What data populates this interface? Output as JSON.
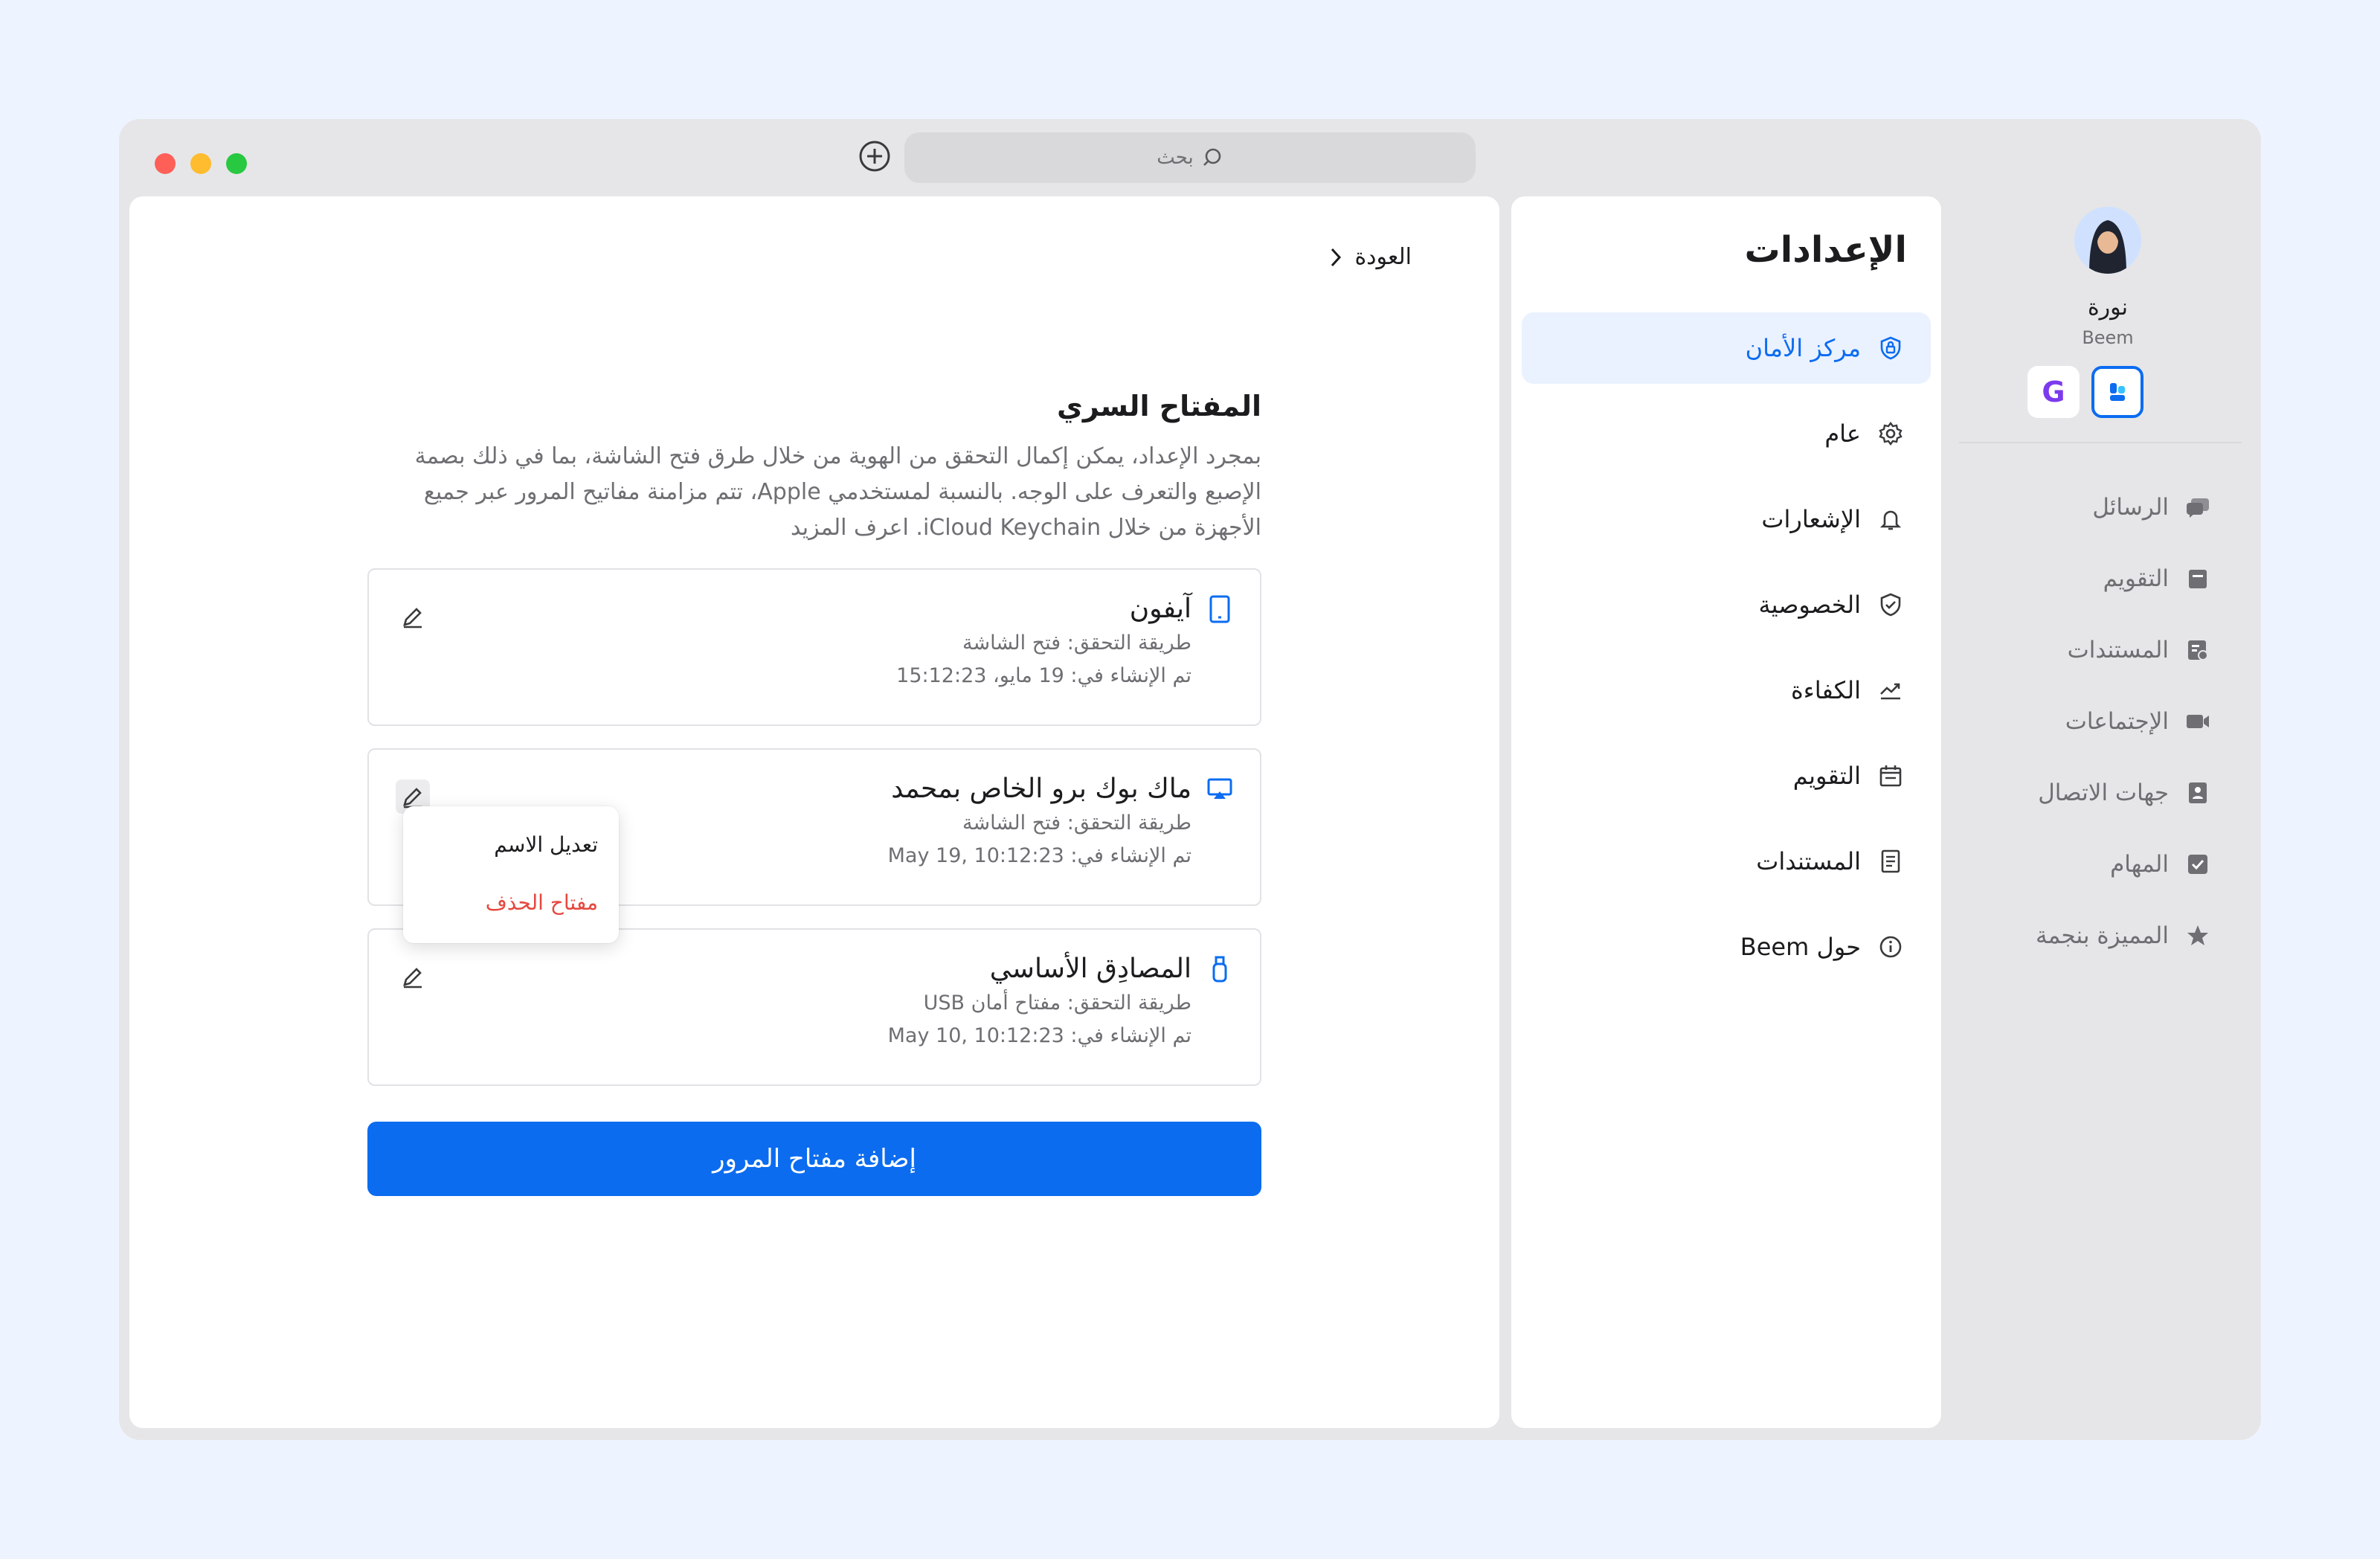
{
  "window": {
    "search_placeholder": "بحث"
  },
  "main": {
    "back_label": "العودة",
    "title": "المفتاح السري",
    "description": "بمجرد الإعداد، يمكن إكمال التحقق من الهوية من خلال طرق فتح الشاشة، بما في ذلك بصمة الإصبع والتعرف على الوجه. بالنسبة لمستخدمي Apple، تتم مزامنة مفاتيح المرور عبر جميع الأجهزة من خلال iCloud Keychain. اعرف المزيد",
    "method_label": "طريقة التحقق:",
    "created_label": "تم الإنشاء في:",
    "keys": [
      {
        "name": "آيفون",
        "icon": "phone-icon",
        "method": "فتح الشاشة",
        "created": "19 مايو، 15:12:23"
      },
      {
        "name": "ماك بوك برو الخاص بمحمد",
        "icon": "laptop-icon",
        "method": "فتح الشاشة",
        "created": "May 19, 10:12:23"
      },
      {
        "name": "المصادِق الأساسي",
        "icon": "usb-key-icon",
        "method": "مفتاح أمان USB",
        "created": "May 10, 10:12:23"
      }
    ],
    "menu": {
      "rename": "تعديل الاسم",
      "delete": "مفتاح الحذف"
    },
    "add_button": "إضافة مفتاح المرور"
  },
  "settings": {
    "title": "الإعدادات",
    "items": [
      {
        "label": "مركز الأمان",
        "icon": "shield-lock-icon",
        "active": true
      },
      {
        "label": "عام",
        "icon": "gear-icon"
      },
      {
        "label": "الإشعارات",
        "icon": "bell-icon"
      },
      {
        "label": "الخصوصية",
        "icon": "shield-check-icon"
      },
      {
        "label": "الكفاءة",
        "icon": "trend-icon"
      },
      {
        "label": "التقويم",
        "icon": "calendar-icon"
      },
      {
        "label": "المستندات",
        "icon": "document-icon"
      },
      {
        "label": "حول Beem",
        "icon": "info-icon"
      }
    ]
  },
  "rail": {
    "user_name": "نورة",
    "org": "Beem",
    "items": [
      {
        "label": "الرسائل",
        "icon": "messages-icon"
      },
      {
        "label": "التقويم",
        "icon": "calendar-icon"
      },
      {
        "label": "المستندات",
        "icon": "documents-icon"
      },
      {
        "label": "الإجتماعات",
        "icon": "video-icon"
      },
      {
        "label": "جهات الاتصال",
        "icon": "contacts-icon"
      },
      {
        "label": "المهام",
        "icon": "tasks-icon"
      },
      {
        "label": "المميزة بنجمة",
        "icon": "star-icon"
      }
    ]
  },
  "colors": {
    "accent": "#0b6cf0",
    "danger": "#e5483f",
    "background": "#eef4ff"
  }
}
